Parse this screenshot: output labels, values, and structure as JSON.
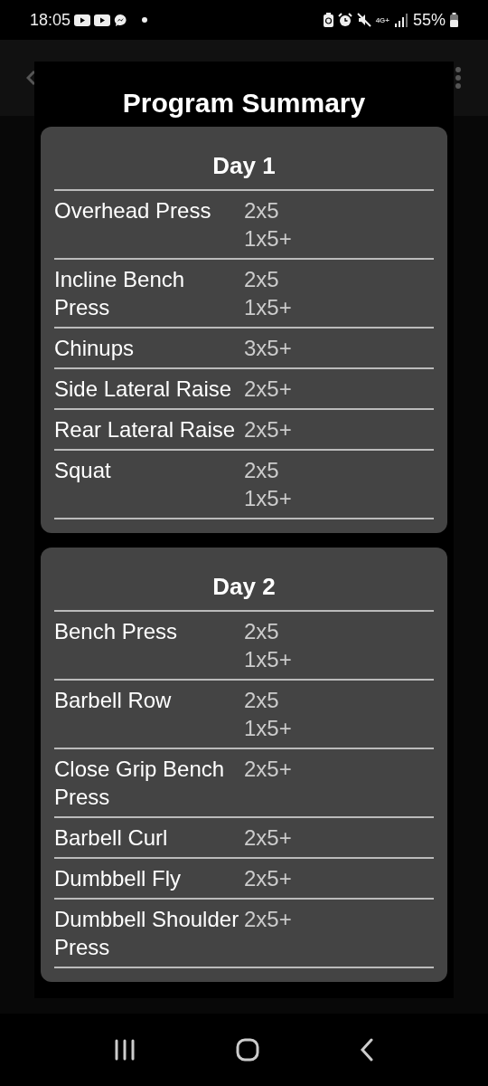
{
  "status_bar": {
    "time": "18:05",
    "network": "4G+",
    "battery": "55%"
  },
  "dialog": {
    "title": "Program Summary",
    "days": [
      {
        "title": "Day 1",
        "exercises": [
          {
            "name": "Overhead Press",
            "sets": [
              "2x5",
              "1x5+"
            ]
          },
          {
            "name": "Incline Bench Press",
            "sets": [
              "2x5",
              "1x5+"
            ]
          },
          {
            "name": "Chinups",
            "sets": [
              "3x5+"
            ]
          },
          {
            "name": "Side Lateral Raise",
            "sets": [
              "2x5+"
            ]
          },
          {
            "name": "Rear Lateral Raise",
            "sets": [
              "2x5+"
            ]
          },
          {
            "name": "Squat",
            "sets": [
              "2x5",
              "1x5+"
            ]
          }
        ]
      },
      {
        "title": "Day 2",
        "exercises": [
          {
            "name": "Bench Press",
            "sets": [
              "2x5",
              "1x5+"
            ]
          },
          {
            "name": "Barbell Row",
            "sets": [
              "2x5",
              "1x5+"
            ]
          },
          {
            "name": "Close Grip Bench Press",
            "sets": [
              "2x5+"
            ]
          },
          {
            "name": "Barbell Curl",
            "sets": [
              "2x5+"
            ]
          },
          {
            "name": "Dumbbell Fly",
            "sets": [
              "2x5+"
            ]
          },
          {
            "name": "Dumbbell Shoulder Press",
            "sets": [
              "2x5+"
            ]
          }
        ]
      }
    ]
  }
}
